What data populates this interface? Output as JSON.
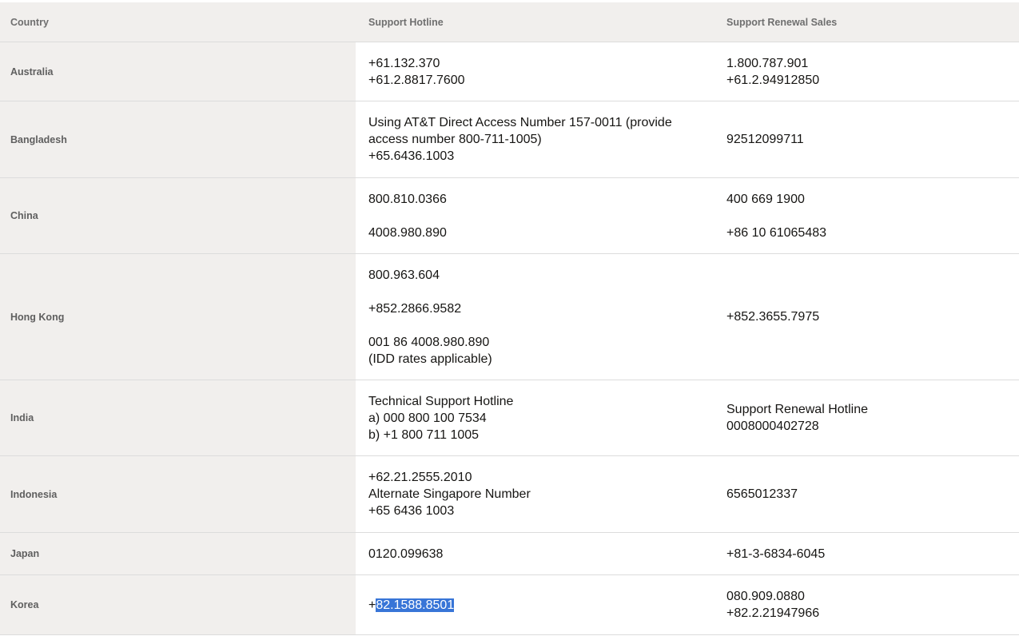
{
  "header": {
    "country": "Country",
    "hotline": "Support Hotline",
    "renewal": "Support Renewal Sales"
  },
  "rows": [
    {
      "country": "Australia",
      "hotline": [
        "+61.132.370",
        "+61.2.8817.7600"
      ],
      "renewal": [
        "1.800.787.901",
        "+61.2.94912850"
      ]
    },
    {
      "country": "Bangladesh",
      "hotline": [
        "Using AT&T Direct Access Number 157-0011 (provide",
        "access number 800-711-1005)",
        "+65.6436.1003"
      ],
      "renewal": [
        "92512099711"
      ]
    },
    {
      "country": "China",
      "hotline": [
        "800.810.0366",
        "4008.980.890"
      ],
      "renewal": [
        "400 669 1900",
        "+86 10 61065483"
      ]
    },
    {
      "country": "Hong Kong",
      "hotline": [
        "800.963.604",
        "+852.2866.9582",
        "001 86 4008.980.890",
        "(IDD rates applicable)"
      ],
      "renewal": [
        "+852.3655.7975"
      ]
    },
    {
      "country": "India",
      "hotline": [
        "Technical Support Hotline",
        "a) 000 800 100 7534",
        "b) +1 800 711 1005"
      ],
      "renewal": [
        "Support Renewal Hotline",
        "0008000402728"
      ]
    },
    {
      "country": "Indonesia",
      "hotline": [
        "+62.21.2555.2010",
        "Alternate Singapore Number",
        "+65 6436 1003"
      ],
      "renewal": [
        "6565012337"
      ]
    },
    {
      "country": "Japan",
      "hotline": [
        "0120.099638"
      ],
      "renewal": [
        "+81-3-6834-6045"
      ]
    },
    {
      "country": "Korea",
      "hotline_prefix": "+",
      "hotline_selected": "82.1588.8501",
      "renewal": [
        "080.909.0880",
        "+82.2.21947966"
      ]
    }
  ]
}
